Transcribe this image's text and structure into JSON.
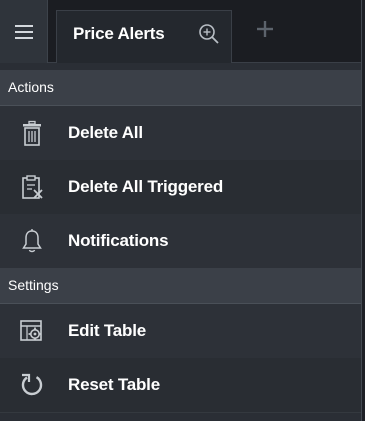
{
  "tabs": {
    "menu_icon": "hamburger-menu-icon",
    "active_tab_label": "Price Alerts",
    "zoom_icon": "zoom-in-icon",
    "add_tab_icon": "plus-icon"
  },
  "sections": {
    "actions": {
      "title": "Actions",
      "items": [
        {
          "label": "Delete All",
          "icon": "trash-icon"
        },
        {
          "label": "Delete All Triggered",
          "icon": "clipboard-delete-icon"
        },
        {
          "label": "Notifications",
          "icon": "bell-icon"
        }
      ]
    },
    "settings": {
      "title": "Settings",
      "items": [
        {
          "label": "Edit Table",
          "icon": "table-gear-icon"
        },
        {
          "label": "Reset Table",
          "icon": "reset-icon"
        }
      ]
    }
  },
  "colors": {
    "background": "#2a2e35",
    "header": "#3b4048",
    "text": "#ffffff",
    "icon": "#c8cdd2"
  }
}
